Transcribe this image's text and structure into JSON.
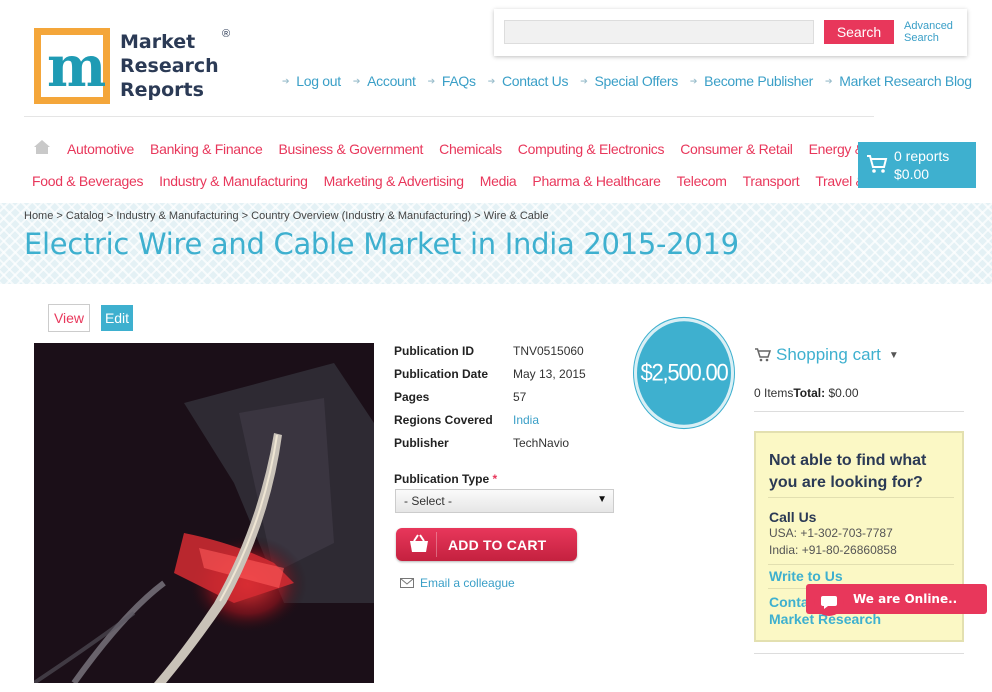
{
  "logo": {
    "line1": "Market",
    "line2": "Research",
    "line3": "Reports",
    "reg": "®"
  },
  "search": {
    "placeholder": "",
    "button": "Search",
    "advanced_line1": "Advanced",
    "advanced_line2": "Search"
  },
  "toplinks": [
    "Log out",
    "Account",
    "FAQs",
    "Contact Us",
    "Special Offers",
    "Become Publisher",
    "Market Research Blog"
  ],
  "nav": {
    "row1": [
      "Automotive",
      "Banking & Finance",
      "Business & Government",
      "Chemicals",
      "Computing & Electronics",
      "Consumer & Retail",
      "Energy & Utilities"
    ],
    "row2": [
      "Food & Beverages",
      "Industry & Manufacturing",
      "Marketing & Advertising",
      "Media",
      "Pharma & Healthcare",
      "Telecom",
      "Transport",
      "Travel & Leisure"
    ]
  },
  "cart": {
    "reports": "0 reports",
    "total": "$0.00"
  },
  "breadcrumb": "Home > Catalog > Industry & Manufacturing > Country Overview (Industry & Manufacturing) > Wire & Cable",
  "title": "Electric Wire and Cable Market in India 2015-2019",
  "tabs": {
    "view": "View",
    "edit": "Edit"
  },
  "details": [
    {
      "label": "Publication ID",
      "value": "TNV0515060"
    },
    {
      "label": "Publication Date",
      "value": "May 13, 2015"
    },
    {
      "label": "Pages",
      "value": "57"
    },
    {
      "label": "Regions Covered",
      "value": "India"
    },
    {
      "label": "Publisher",
      "value": "TechNavio"
    }
  ],
  "pubtype": {
    "label": "Publication Type",
    "required": "*",
    "selected": "- Select -"
  },
  "add_to_cart": "ADD TO CART",
  "email_colleague": "Email a colleague",
  "price": "$2,500.00",
  "shopping_cart": {
    "title": "Shopping cart",
    "items": "0 Items",
    "total_label": "Total:",
    "total_value": "$0.00"
  },
  "help": {
    "title": "Not able to find what you are looking for?",
    "call_us": "Call Us",
    "usa": "USA: +1-302-703-7787",
    "india": "India: +91-80-26860858",
    "write": "Write to Us",
    "contact_line1": "Conta",
    "contact_line2": "Market Research"
  },
  "chat": "We are Online.."
}
